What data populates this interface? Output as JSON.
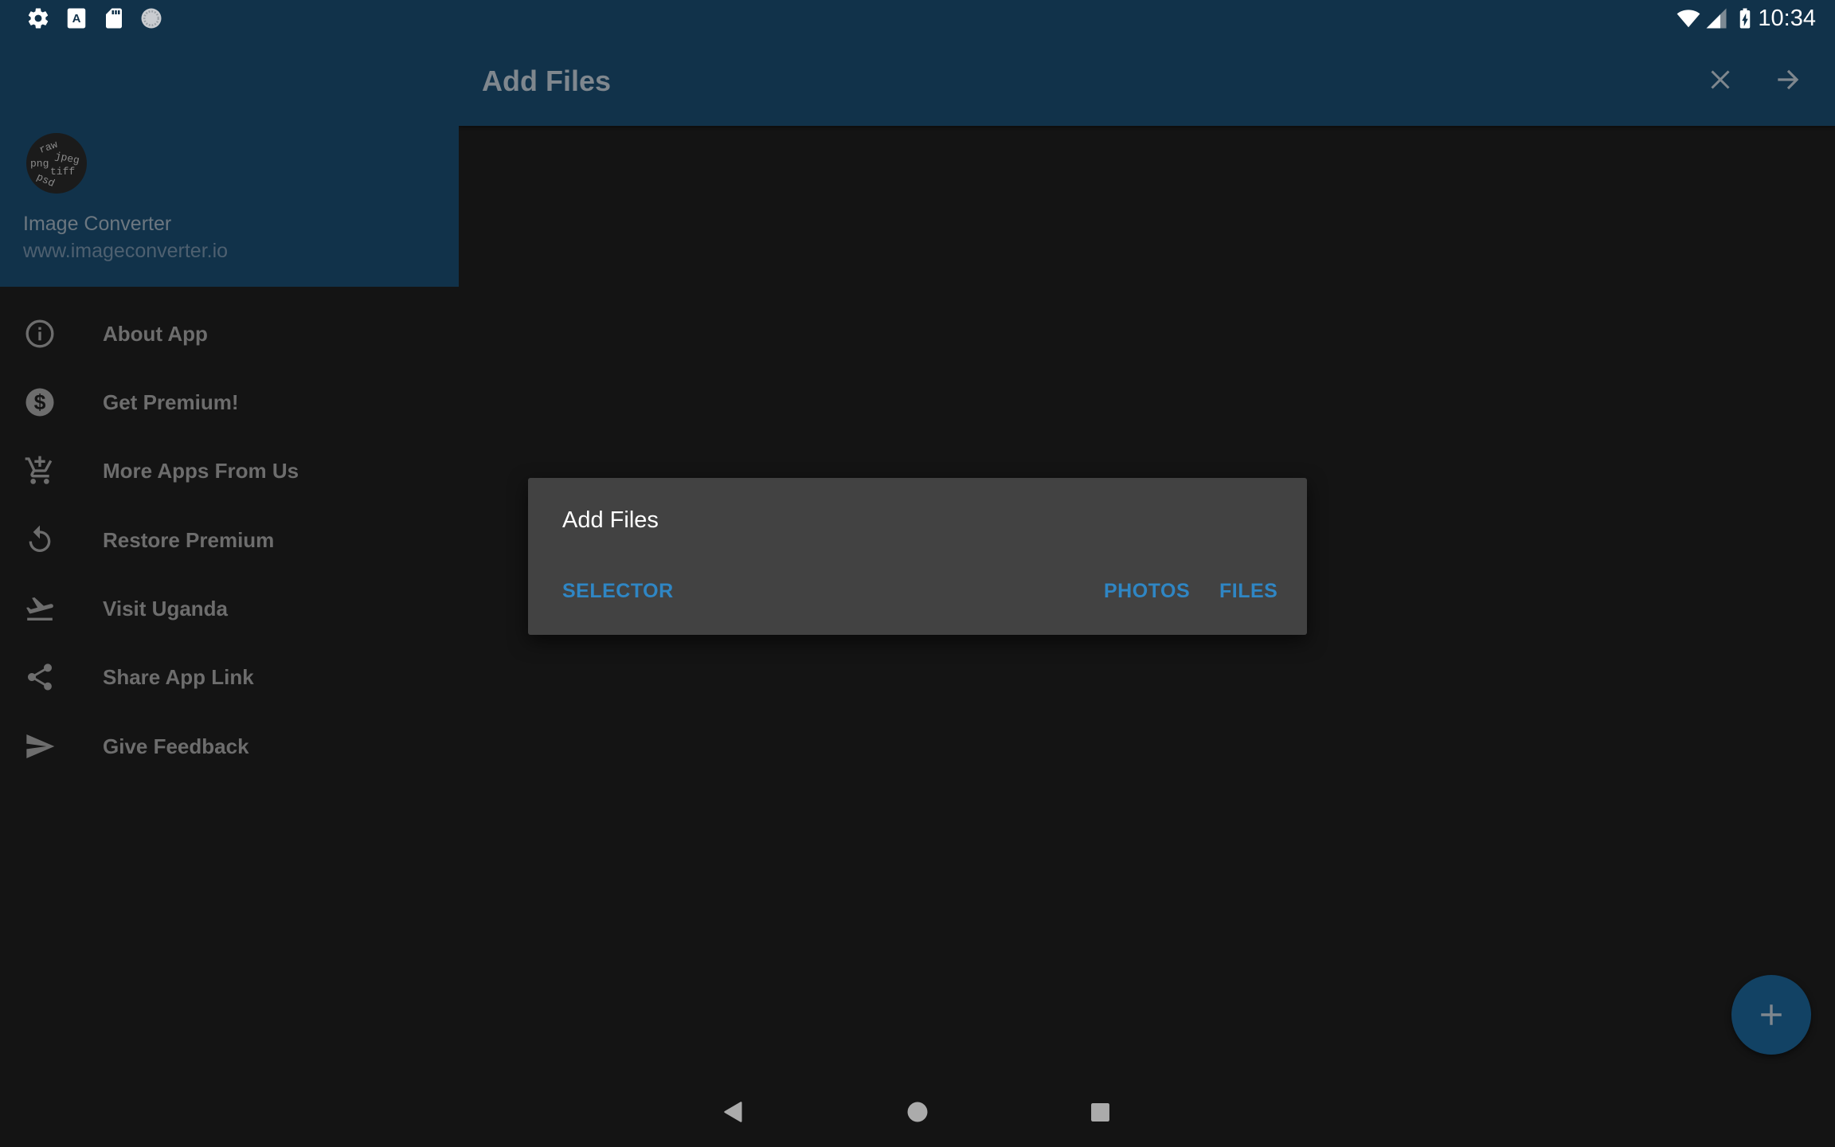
{
  "status_bar": {
    "left_icons": [
      "settings-icon",
      "keyboard-icon",
      "sd-card-icon",
      "sync-icon"
    ],
    "right_icons": [
      "wifi-icon",
      "signal-icon",
      "battery-charging-icon"
    ],
    "time": "10:34"
  },
  "app_bar": {
    "title": "Add Files",
    "actions": [
      {
        "icon": "close-icon",
        "label": "Close"
      },
      {
        "icon": "arrow-forward-icon",
        "label": "Next"
      }
    ]
  },
  "drawer": {
    "app_name": "Image Converter",
    "app_url": "www.imageconverter.io",
    "logo_words": [
      "raw",
      "jpeg",
      "png",
      "tiff",
      "psd"
    ],
    "items": [
      {
        "label": "About App",
        "icon": "info-icon"
      },
      {
        "label": "Get Premium!",
        "icon": "dollar-icon"
      },
      {
        "label": "More Apps From Us",
        "icon": "add-cart-icon"
      },
      {
        "label": "Restore Premium",
        "icon": "restore-icon"
      },
      {
        "label": "Visit Uganda",
        "icon": "flight-takeoff-icon"
      },
      {
        "label": "Share App Link",
        "icon": "share-icon"
      },
      {
        "label": "Give Feedback",
        "icon": "send-icon"
      }
    ]
  },
  "dialog": {
    "title": "Add Files",
    "buttons": {
      "selector": "SELECTOR",
      "photos": "PHOTOS",
      "files": "FILES"
    },
    "accent_color": "#2f86c4"
  },
  "fab": {
    "icon": "plus-icon",
    "label": "Add"
  },
  "nav_bar": {
    "buttons": [
      "back-icon",
      "home-icon",
      "recents-icon"
    ]
  },
  "colors": {
    "primary": "#11324a",
    "background": "#141414",
    "dialog": "#424242",
    "fab": "#124264"
  }
}
